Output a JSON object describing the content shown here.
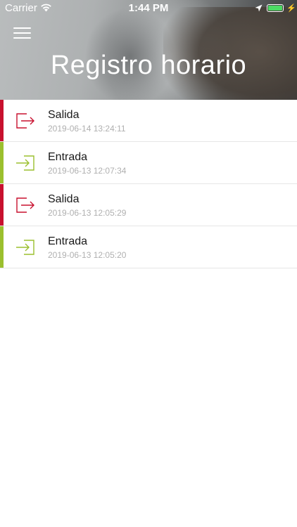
{
  "status_bar": {
    "carrier": "Carrier",
    "time": "1:44 PM",
    "battery_color": "#4cd964"
  },
  "header": {
    "title": "Registro horario",
    "menu_icon": "hamburger-menu-icon"
  },
  "colors": {
    "exit_accent": "#c8102e",
    "entry_accent": "#9bbf2e"
  },
  "entries": [
    {
      "type": "exit",
      "label": "Salida",
      "timestamp": "2019-06-14 13:24:11",
      "icon": "logout-icon"
    },
    {
      "type": "entry",
      "label": "Entrada",
      "timestamp": "2019-06-13 12:07:34",
      "icon": "login-icon"
    },
    {
      "type": "exit",
      "label": "Salida",
      "timestamp": "2019-06-13 12:05:29",
      "icon": "logout-icon"
    },
    {
      "type": "entry",
      "label": "Entrada",
      "timestamp": "2019-06-13 12:05:20",
      "icon": "login-icon"
    }
  ]
}
